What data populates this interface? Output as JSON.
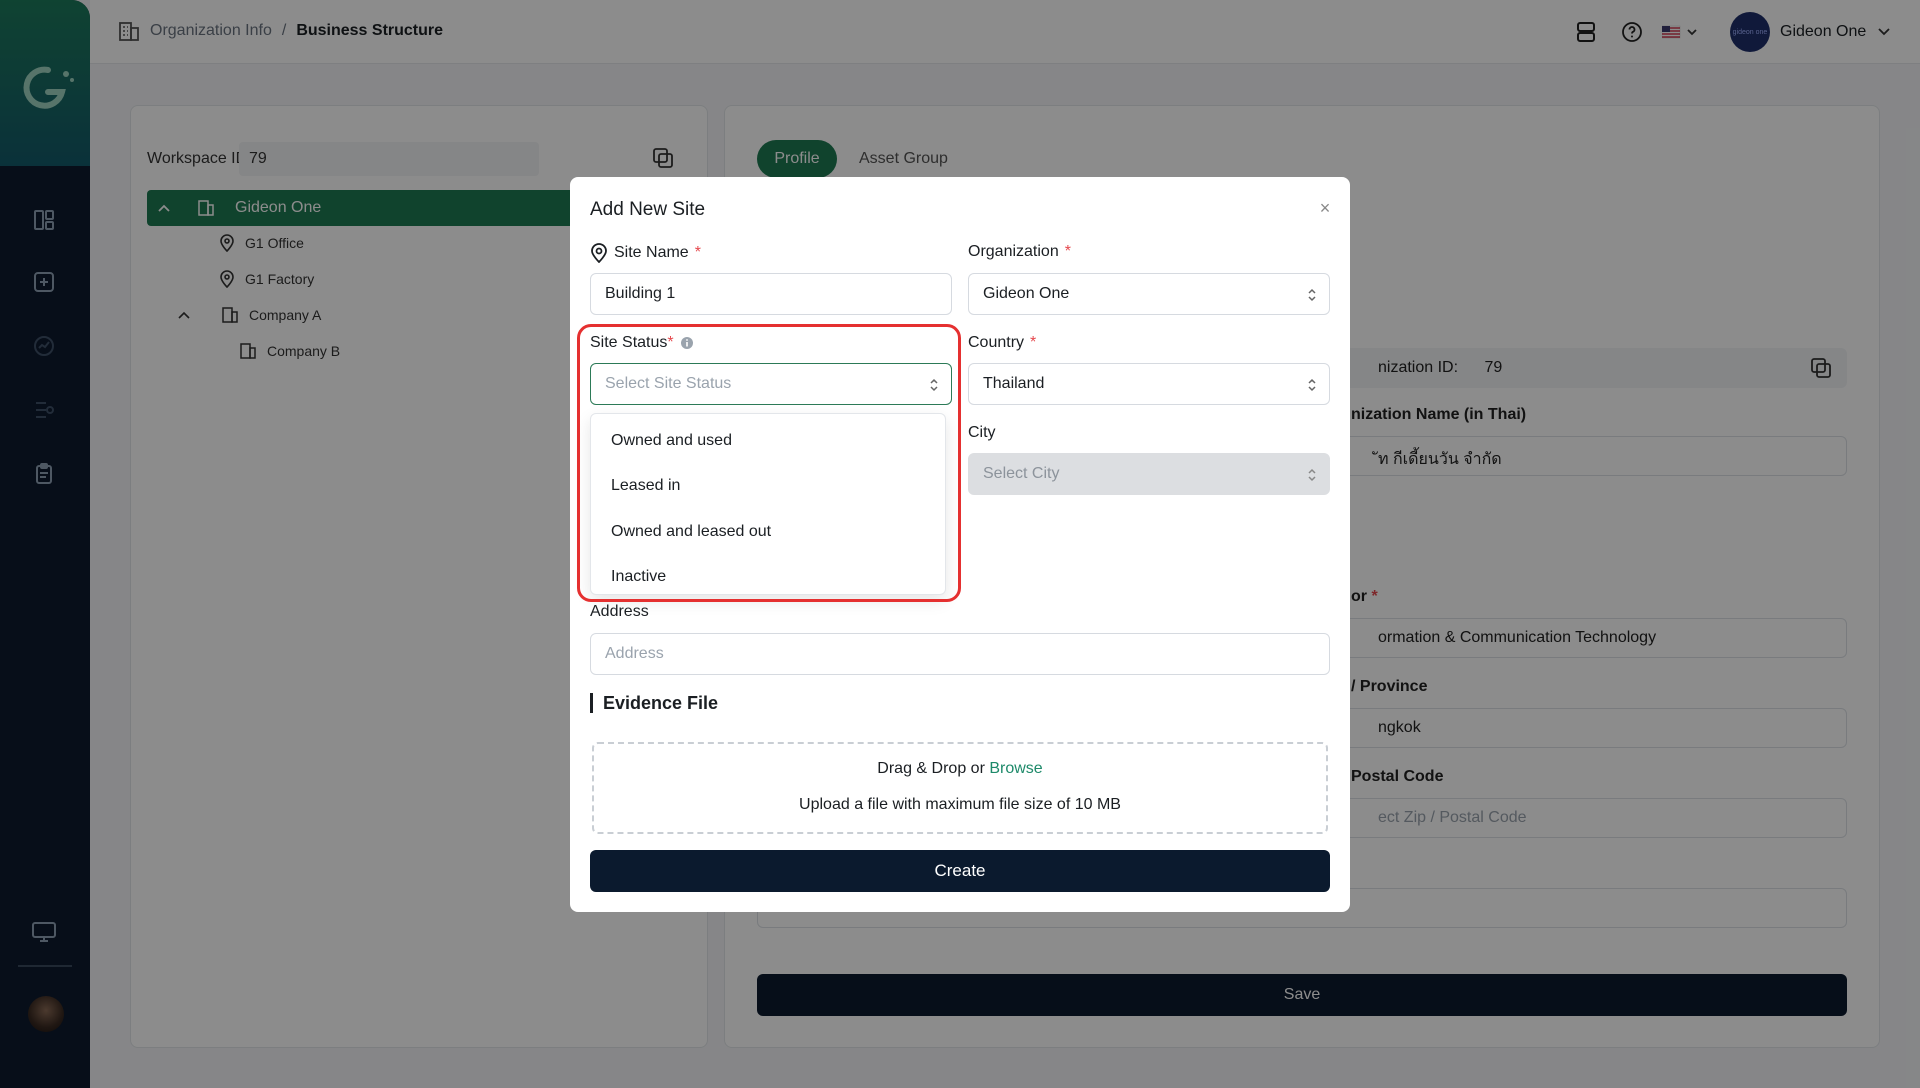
{
  "breadcrumb": {
    "parent": "Organization Info",
    "separator": "/",
    "current": "Business Structure"
  },
  "user": {
    "name": "Gideon One",
    "avatar_text": "gideon one"
  },
  "left_panel": {
    "workspace_label": "Workspace ID:",
    "workspace_id": "79",
    "tree": [
      {
        "label": "Gideon One"
      },
      {
        "label": "G1 Office"
      },
      {
        "label": "G1 Factory"
      },
      {
        "label": "Company A"
      },
      {
        "label": "Company B"
      }
    ]
  },
  "right_panel": {
    "tabs": [
      "Profile",
      "Asset Group"
    ],
    "org_id_label": "nization ID:",
    "org_id": "79",
    "org_name_thai_label": "nization Name (in Thai)",
    "org_name_thai_value": "ัท กีเดี้ยนวัน จำกัด",
    "sector_label": "or",
    "sector_value": "ormation & Communication Technology",
    "province_label": "/ Province",
    "province_value": "ngkok",
    "postal_label": "Postal Code",
    "postal_placeholder": "ect Zip / Postal Code",
    "save_label": "Save"
  },
  "modal": {
    "title": "Add New Site",
    "close": "×",
    "site_name": {
      "label": "Site Name",
      "required": "*",
      "value": "Building 1"
    },
    "organization": {
      "label": "Organization",
      "required": "*",
      "value": "Gideon One"
    },
    "site_status": {
      "label": "Site Status",
      "required": "*",
      "placeholder": "Select Site Status",
      "options": [
        "Owned and used",
        "Leased in",
        "Owned and leased out",
        "Inactive"
      ]
    },
    "country": {
      "label": "Country",
      "required": "*",
      "value": "Thailand"
    },
    "city": {
      "label": "City",
      "placeholder": "Select City"
    },
    "address": {
      "label": "Address",
      "placeholder": "Address"
    },
    "evidence": {
      "title": "Evidence File",
      "drag_text": "Drag & Drop or",
      "browse": "Browse",
      "hint": "Upload a file with maximum file size of 10 MB"
    },
    "create_label": "Create"
  },
  "colors": {
    "accent": "#1e7a52",
    "primary_button": "#0b1a2e",
    "highlight": "#e53030",
    "required": "#e5484d"
  }
}
